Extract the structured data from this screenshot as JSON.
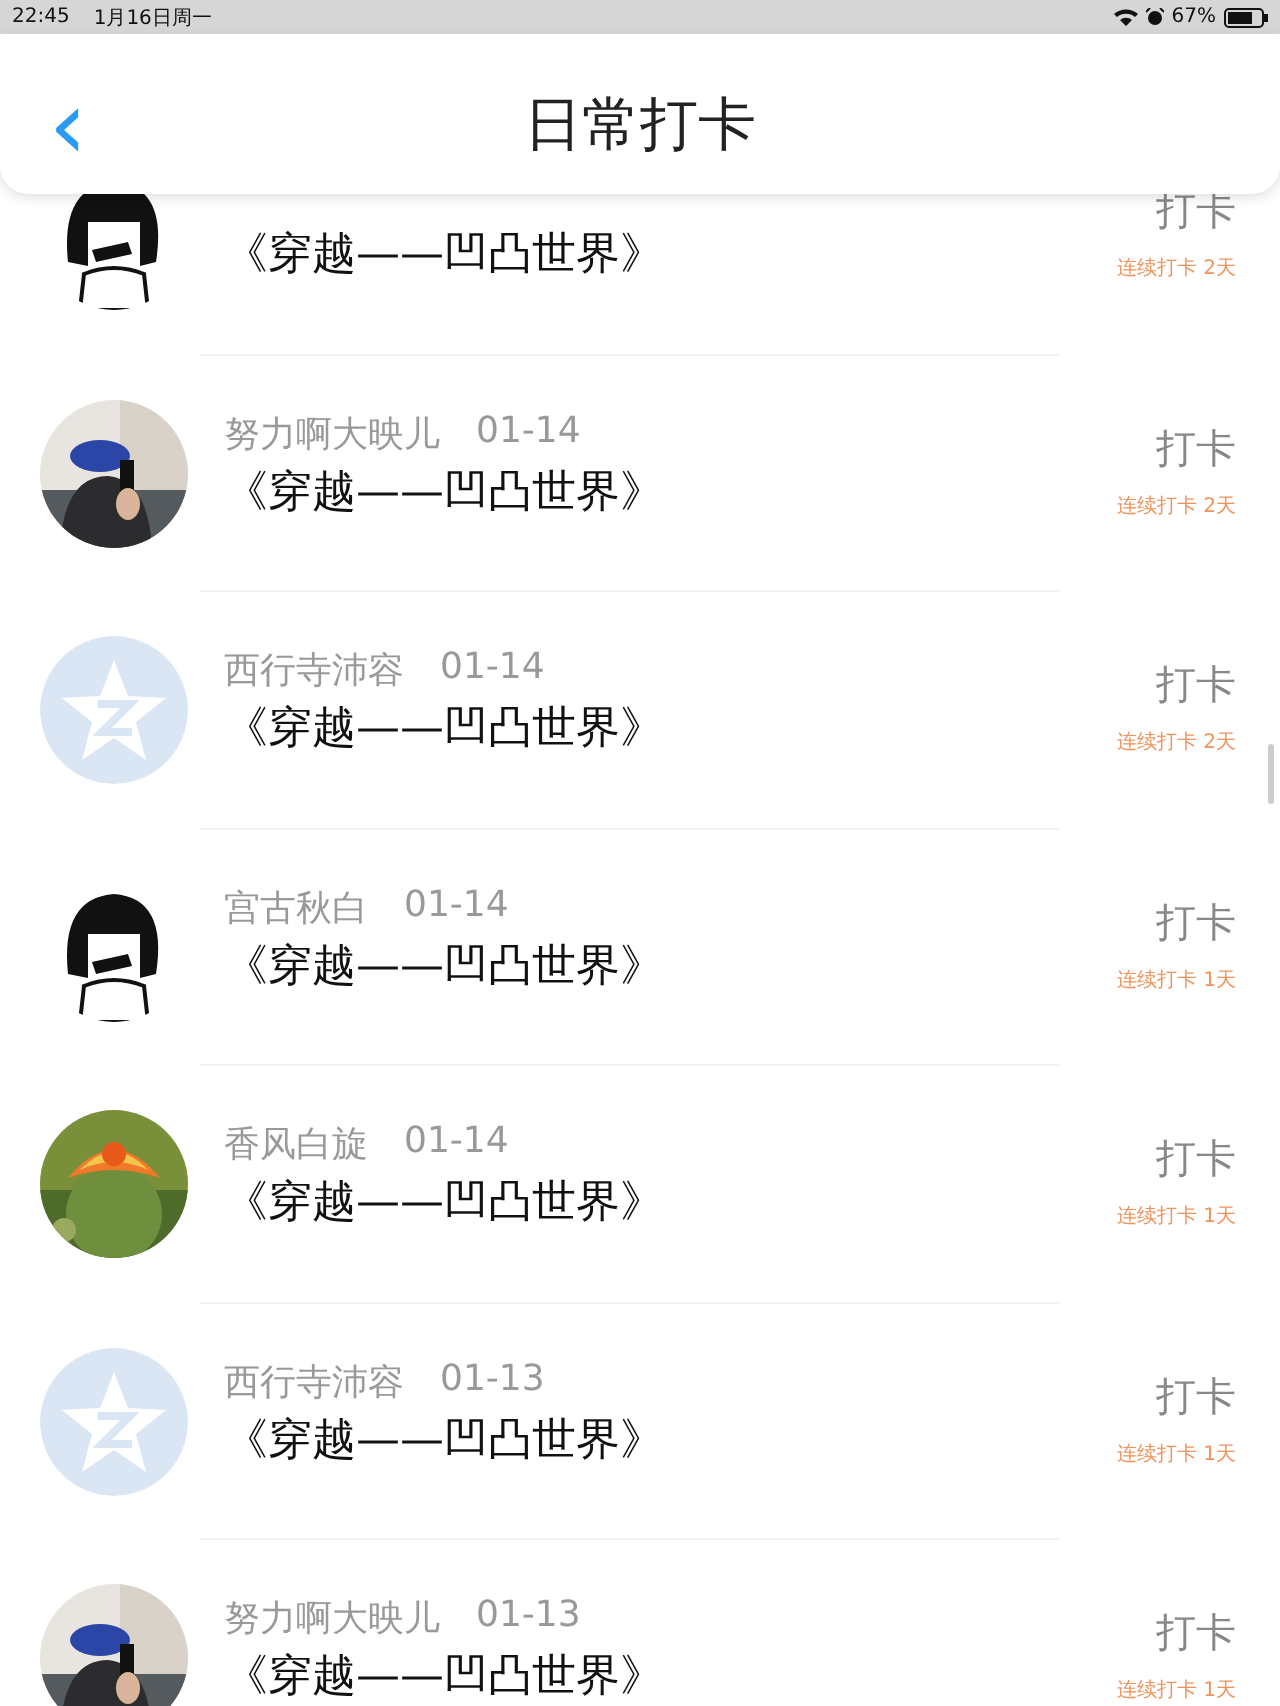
{
  "status_bar": {
    "time": "22:45",
    "date": "1月16日周一",
    "battery": "67%"
  },
  "header": {
    "back": "‹",
    "title": "日常打卡"
  },
  "rows": [
    {
      "avatar": {
        "kind": "cartoon"
      },
      "title": "《穿越——凹凸世界》",
      "action": "打卡",
      "streak": "连续打卡 2天"
    },
    {
      "name": "努力啊大映儿",
      "date": "01-14",
      "title": "《穿越——凹凸世界》",
      "action": "打卡",
      "streak": "连续打卡 2天"
    },
    {
      "avatar": {
        "kind": "default"
      },
      "name": "西行寺沛容",
      "date": "01-14",
      "title": "《穿越——凹凸世界》",
      "action": "打卡",
      "streak": "连续打卡 2天"
    },
    {
      "avatar": {
        "kind": "cartoon"
      },
      "name": "宫古秋白",
      "date": "01-14",
      "title": "《穿越——凹凸世界》",
      "action": "打卡",
      "streak": "连续打卡 1天"
    },
    {
      "avatar": {
        "kind": "plant"
      },
      "name": "香风白旋",
      "date": "01-14",
      "title": "《穿越——凹凸世界》",
      "action": "打卡",
      "streak": "连续打卡 1天"
    },
    {
      "avatar": {
        "kind": "default"
      },
      "name": "西行寺沛容",
      "date": "01-13",
      "title": "《穿越——凹凸世界》",
      "action": "打卡",
      "streak": "连续打卡 1天"
    },
    {
      "name": "努力啊大映儿",
      "date": "01-13",
      "title": "《穿越——凹凸世界》",
      "action": "打卡",
      "streak": "连续打卡 1天"
    }
  ]
}
